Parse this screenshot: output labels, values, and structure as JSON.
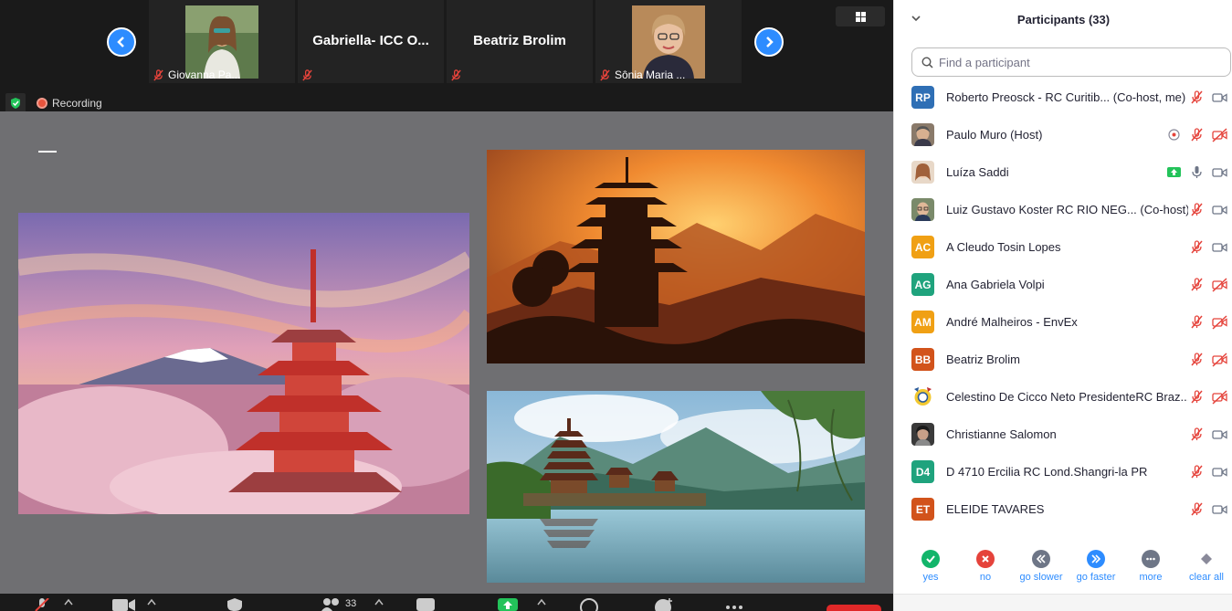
{
  "filmstrip": {
    "tiles": [
      {
        "name": "Giovanna Pa..."
      },
      {
        "name": "Gabriella-  ICC  O..."
      },
      {
        "name": "Beatriz Brolim"
      },
      {
        "name": "Sônia Maria ..."
      }
    ]
  },
  "status": {
    "recording_label": "Recording"
  },
  "toolbar": {
    "participants_count": "33"
  },
  "panel": {
    "title": "Participants (33)",
    "search_placeholder": "Find a participant",
    "participants": [
      {
        "initials": "RP",
        "name": "Roberto Preosck - RC Curitib...  (Co-host, me)",
        "color": "#2f6fb5"
      },
      {
        "initials": "",
        "name": "Paulo Muro (Host)",
        "color": "#7a6a5a"
      },
      {
        "initials": "",
        "name": "Luíza Saddi",
        "color": "#c9a07a"
      },
      {
        "initials": "",
        "name": "Luiz Gustavo Koster RC RIO NEG...  (Co-host)",
        "color": "#5a6a4a"
      },
      {
        "initials": "AC",
        "name": "A Cleudo Tosin Lopes",
        "color": "#f0a014"
      },
      {
        "initials": "AG",
        "name": "Ana Gabriela Volpi",
        "color": "#1fa37d"
      },
      {
        "initials": "AM",
        "name": "André Malheiros - EnvEx",
        "color": "#f0a014"
      },
      {
        "initials": "BB",
        "name": "Beatriz Brolim",
        "color": "#d2531b"
      },
      {
        "initials": "",
        "name": "Celestino De Cicco Neto PresidenteRC Braz...",
        "color": "#e8c547"
      },
      {
        "initials": "",
        "name": "Christianne Salomon",
        "color": "#4a4a4a"
      },
      {
        "initials": "D4",
        "name": "D 4710 Ercilia RC Lond.Shangri-la PR",
        "color": "#1fa37d"
      },
      {
        "initials": "ET",
        "name": "ELEIDE TAVARES",
        "color": "#d2531b"
      }
    ],
    "reactions": [
      {
        "label": "yes",
        "color": "#12b56a"
      },
      {
        "label": "no",
        "color": "#e5433b"
      },
      {
        "label": "go slower",
        "color": "#6e7687"
      },
      {
        "label": "go faster",
        "color": "#2d8cff"
      },
      {
        "label": "more",
        "color": "#6e7687"
      },
      {
        "label": "clear all",
        "color": "#8a8a9a"
      }
    ]
  }
}
